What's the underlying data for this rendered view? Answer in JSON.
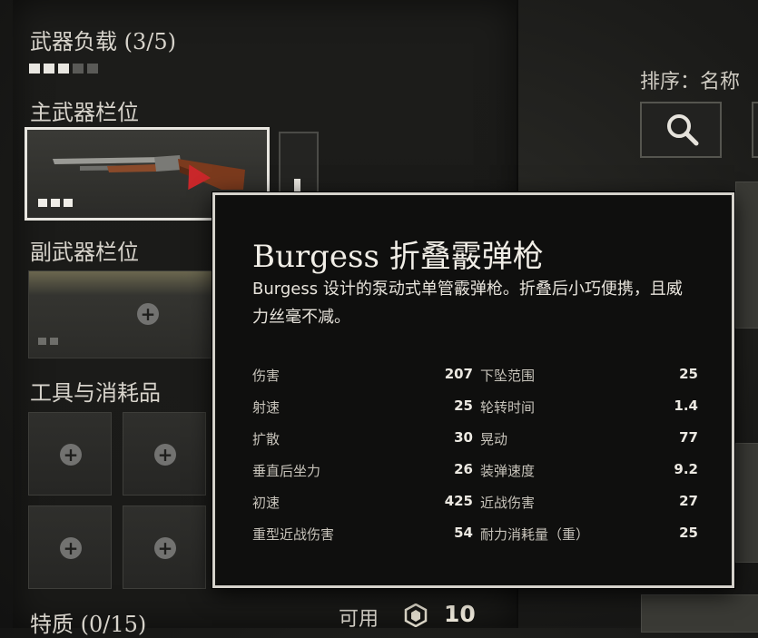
{
  "loadout": {
    "weapons_title": "武器负载 (3/5)",
    "primary_slot_label": "主武器栏位",
    "secondary_slot_label": "副武器栏位",
    "tools_label": "工具与消耗品",
    "traits_label": "特质 (0/15)",
    "available_label": "可用",
    "available_value": "10",
    "weight_pips_filled": 3,
    "weight_pips_total": 5
  },
  "sort": {
    "label": "排序：名称"
  },
  "tooltip": {
    "title": "Burgess 折叠霰弹枪",
    "description": "Burgess 设计的泵动式单管霰弹枪。折叠后小巧便携，且威力丝毫不减。",
    "stats_left": [
      {
        "label": "伤害",
        "value": "207"
      },
      {
        "label": "射速",
        "value": "25"
      },
      {
        "label": "扩散",
        "value": "30"
      },
      {
        "label": "垂直后坐力",
        "value": "26"
      },
      {
        "label": "初速",
        "value": "425"
      },
      {
        "label": "重型近战伤害",
        "value": "54"
      }
    ],
    "stats_right": [
      {
        "label": "下坠范围",
        "value": "25"
      },
      {
        "label": "轮转时间",
        "value": "1.4"
      },
      {
        "label": "晃动",
        "value": "77"
      },
      {
        "label": "装弹速度",
        "value": "9.2"
      },
      {
        "label": "近战伤害",
        "value": "27"
      },
      {
        "label": "耐力消耗量（重）",
        "value": "25"
      }
    ]
  },
  "colors": {
    "accent_marker": "#c9272a",
    "tooltip_border": "#d5d2cb"
  }
}
